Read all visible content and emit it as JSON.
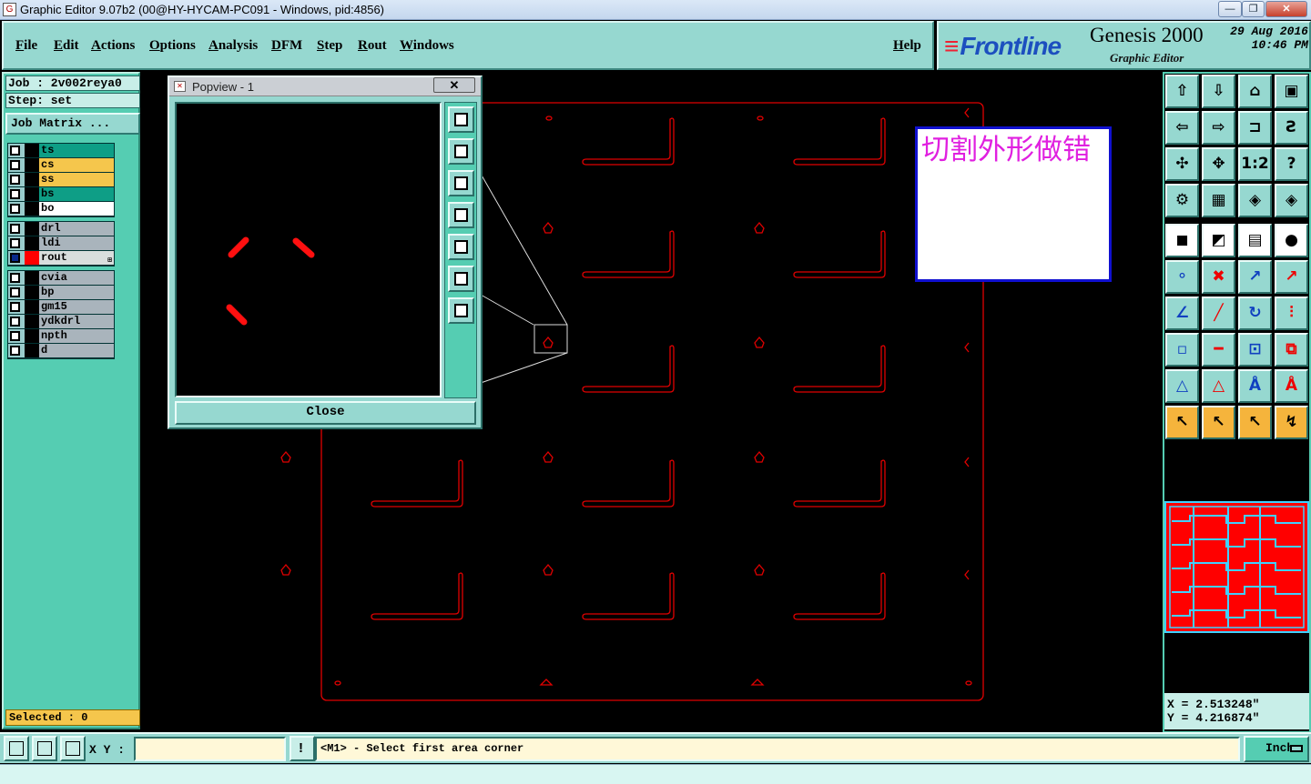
{
  "window": {
    "title": "Graphic Editor 9.07b2 (00@HY-HYCAM-PC091 - Windows, pid:4856)",
    "minimize_label": "—",
    "restore_label": "❐",
    "close_label": "✕"
  },
  "menu": {
    "file": "File",
    "edit": "Edit",
    "actions": "Actions",
    "options": "Options",
    "analysis": "Analysis",
    "dfm": "DFM",
    "step": "Step",
    "rout": "Rout",
    "windows": "Windows",
    "help": "Help"
  },
  "brand": {
    "logo": "Frontline",
    "product": "Genesis 2000",
    "subtitle": "Graphic Editor",
    "date": "29 Aug 2016",
    "time": "10:46 PM"
  },
  "job": {
    "job_line": "Job : 2v002reya0",
    "step_line": "Step: set",
    "matrix_button": "Job Matrix ..."
  },
  "layers": {
    "group1": [
      {
        "name": "ts",
        "color": "#0e9e86"
      },
      {
        "name": "cs",
        "color": "#f5c64c"
      },
      {
        "name": "ss",
        "color": "#f5c64c"
      },
      {
        "name": "bs",
        "color": "#0e9e86"
      },
      {
        "name": "bo",
        "color": "#ffffff"
      }
    ],
    "group2": [
      {
        "name": "drl",
        "color": "#a9b4bc"
      },
      {
        "name": "ldi",
        "color": "#a9b4bc"
      },
      {
        "name": "rout",
        "color": "#d9dedd"
      }
    ],
    "group3": [
      {
        "name": "cvia",
        "color": "#a9b4bc"
      },
      {
        "name": "bp",
        "color": "#a9b4bc"
      },
      {
        "name": "gm15",
        "color": "#a9b4bc"
      },
      {
        "name": "ydkdrl",
        "color": "#a9b4bc"
      },
      {
        "name": "npth",
        "color": "#a9b4bc"
      },
      {
        "name": "d",
        "color": "#a9b4bc"
      }
    ],
    "active_marker": "⊞"
  },
  "selected_label": "Selected : 0",
  "note_text": "切割外形做错",
  "popview": {
    "title": "Popview - 1",
    "close_x": "✕",
    "close_button": "Close"
  },
  "coords": {
    "x": "X = 2.513248\"",
    "y": "Y = 4.216874\""
  },
  "status": {
    "xy_label": "X Y :",
    "xy_value": "",
    "warning": "!",
    "message": "<M1> - Select first area corner",
    "units": "Inch"
  },
  "toolbox_icons": [
    "zoom-home-icon",
    "zoom-back-icon",
    "home-icon",
    "window-icon",
    "pan-left-icon",
    "pan-right-icon",
    "fit-icon",
    "snap-icon",
    "zoom-fit-icon",
    "zoom-center-icon",
    "scale-icon",
    "help-icon",
    "measure-icon",
    "grid-icon",
    "layer-view-icon",
    "layer-view-2-icon"
  ],
  "colors": {
    "rout_line": "#e00000",
    "panel_teal": "#96d8d0",
    "toolbox_teal": "#55cdb2",
    "note_text": "#e020e0"
  }
}
